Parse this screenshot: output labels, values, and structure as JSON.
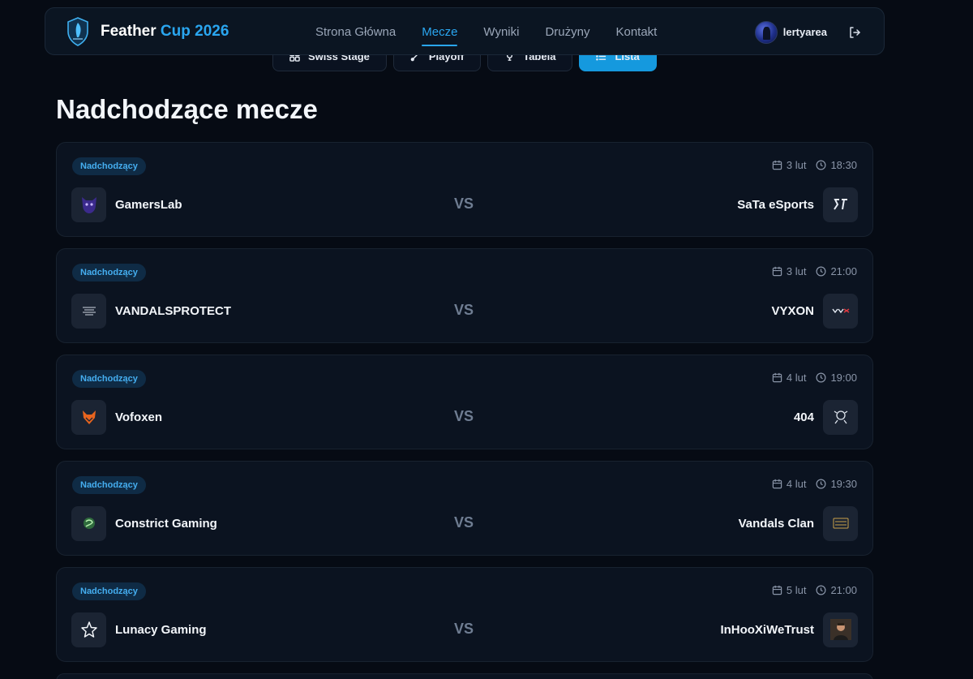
{
  "header": {
    "brand_main": "Feather",
    "brand_accent": "Cup 2026",
    "nav": [
      "Strona Główna",
      "Mecze",
      "Wyniki",
      "Drużyny",
      "Kontakt"
    ],
    "active_nav": "Mecze",
    "username": "lertyarea",
    "icons": {
      "logo": "feather-shield-logo",
      "logout": "logout-icon"
    }
  },
  "view_tabs": [
    {
      "label": "Swiss Stage",
      "icon": "grid-icon",
      "active": false
    },
    {
      "label": "Playoff",
      "icon": "bracket-icon",
      "active": false
    },
    {
      "label": "Tabela",
      "icon": "trophy-icon",
      "active": false
    },
    {
      "label": "Lista",
      "icon": "list-icon",
      "active": true
    }
  ],
  "page_title": "Nadchodzące mecze",
  "vs_label": "VS",
  "matches": [
    {
      "status": "Nadchodzący",
      "date": "3 lut",
      "time": "18:30",
      "team1": "GamersLab",
      "team2": "SaTa eSports"
    },
    {
      "status": "Nadchodzący",
      "date": "3 lut",
      "time": "21:00",
      "team1": "VANDALSPROTECT",
      "team2": "VYXON"
    },
    {
      "status": "Nadchodzący",
      "date": "4 lut",
      "time": "19:00",
      "team1": "Vofoxen",
      "team2": "404"
    },
    {
      "status": "Nadchodzący",
      "date": "4 lut",
      "time": "19:30",
      "team1": "Constrict Gaming",
      "team2": "Vandals Clan"
    },
    {
      "status": "Nadchodzący",
      "date": "5 lut",
      "time": "21:00",
      "team1": "Lunacy Gaming",
      "team2": "InHooXiWeTrust"
    }
  ],
  "colors": {
    "accent": "#2aa6f0",
    "background": "#060b14",
    "card": "#0b1320",
    "badge_bg": "#0f2b45"
  }
}
